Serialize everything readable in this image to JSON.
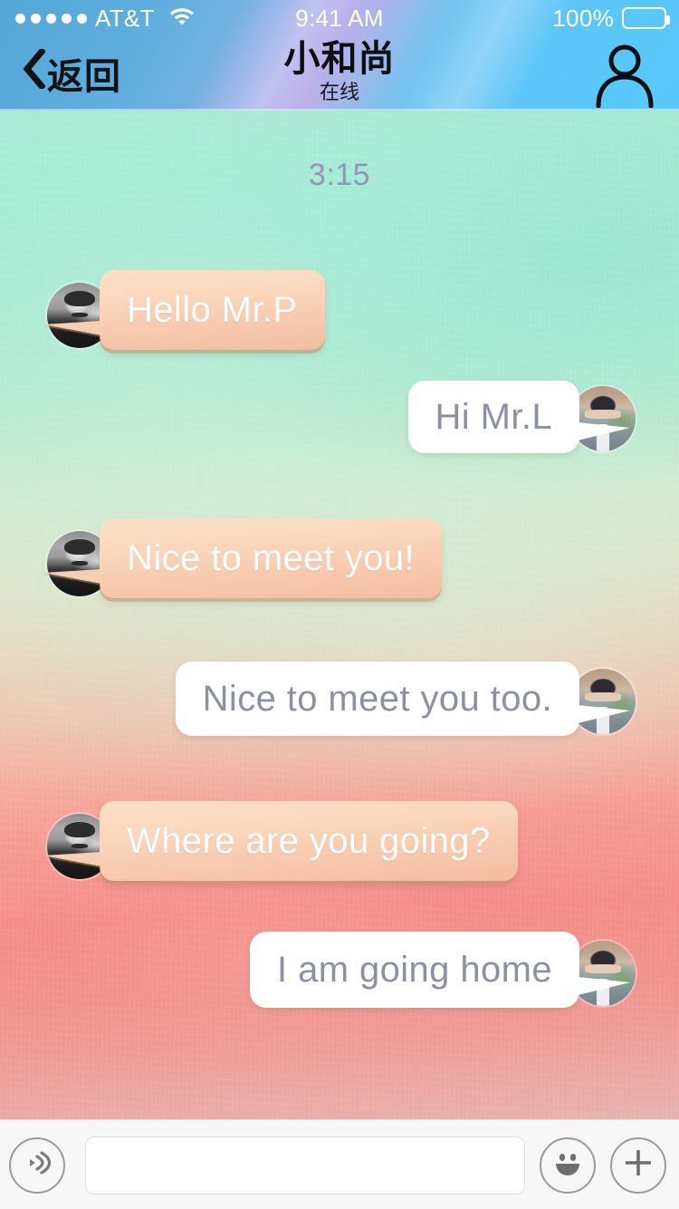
{
  "status_bar": {
    "signal_dots": 5,
    "carrier": "AT&T",
    "wifi_icon": "wifi-icon",
    "time": "9:41 AM",
    "battery_percent": "100%",
    "battery_icon": "battery-full-icon"
  },
  "header": {
    "back_label": "返回",
    "back_icon": "chevron-left-icon",
    "title": "小和尚",
    "subtitle": "在线",
    "profile_icon": "person-icon",
    "background_color": "#5fbdf0"
  },
  "chat": {
    "timestamp": "3:15",
    "incoming_bubble_color": "#f8d3b8",
    "outgoing_bubble_color": "#ffffff",
    "incoming_text_color": "#ffffff",
    "outgoing_text_color": "#8c91a1",
    "messages": [
      {
        "side": "left",
        "text": "Hello Mr.P",
        "avatar": "avatar-man"
      },
      {
        "side": "right",
        "text": "Hi Mr.L",
        "avatar": "avatar-person"
      },
      {
        "side": "left",
        "text": "Nice to meet you!",
        "avatar": "avatar-man"
      },
      {
        "side": "right",
        "text": "Nice to meet you too.",
        "avatar": "avatar-person"
      },
      {
        "side": "left",
        "text": "Where are you going?",
        "avatar": "avatar-man"
      },
      {
        "side": "right",
        "text": "I am going home",
        "avatar": "avatar-person"
      }
    ]
  },
  "input_bar": {
    "voice_icon": "voice-wave-icon",
    "input_value": "",
    "input_placeholder": "",
    "emoji_icon": "smiley-icon",
    "add_icon": "plus-icon"
  }
}
